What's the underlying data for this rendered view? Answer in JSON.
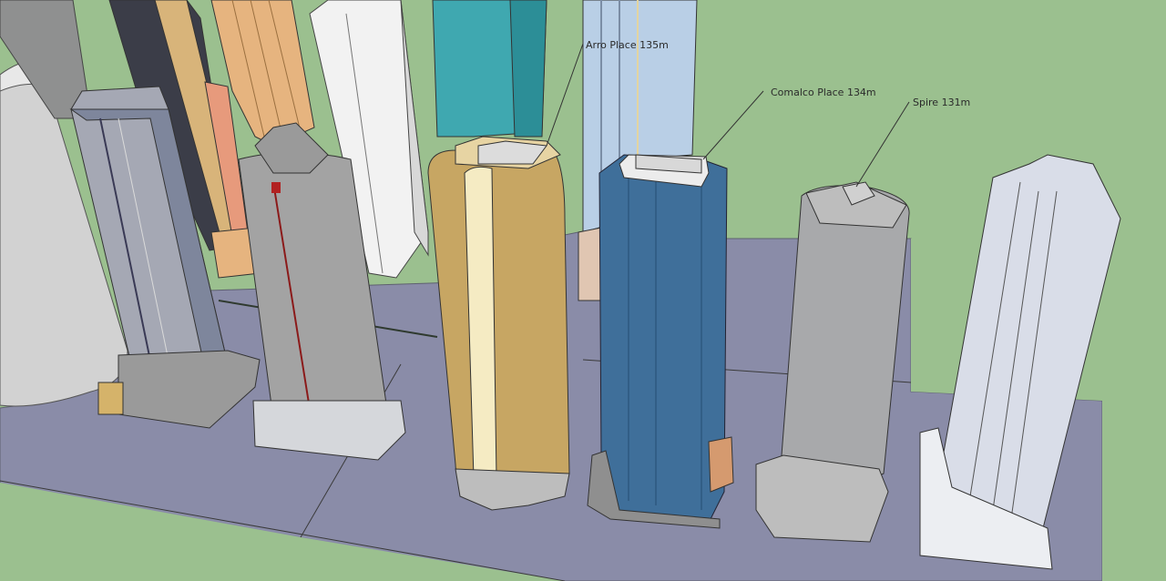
{
  "viewport": {
    "title": "",
    "background_color": "#9bc08f",
    "ground_color": "#8a8ca8"
  },
  "annotations": [
    {
      "id": "arro",
      "text": "Arro Place 135m"
    },
    {
      "id": "comalco",
      "text": "Comalco Place 134m"
    },
    {
      "id": "spire",
      "text": "Spire 131m"
    }
  ],
  "buildings": [
    {
      "name": "grey-cylinder-left",
      "color": "#d2d2d2"
    },
    {
      "name": "grey-striped-tower",
      "color": "#a5a8b4"
    },
    {
      "name": "gold-striped-tower",
      "color": "#d8b47a"
    },
    {
      "name": "orange-striped-tower",
      "color": "#e6b47f"
    },
    {
      "name": "white-tower",
      "color": "#f2f2f2"
    },
    {
      "name": "cylindrical-tower-red-stripe",
      "color": "#a3a3a3"
    },
    {
      "name": "teal-tower",
      "color": "#3fa8b0"
    },
    {
      "name": "blue-glass-tower",
      "color": "#b9cfe6"
    },
    {
      "name": "tan-tower",
      "color": "#c7a663"
    },
    {
      "name": "dark-blue-tower",
      "color": "#3f6f9a"
    },
    {
      "name": "grey-tower-spire",
      "color": "#a8a9ab"
    },
    {
      "name": "white-light-tower-right",
      "color": "#d9dde8"
    }
  ]
}
